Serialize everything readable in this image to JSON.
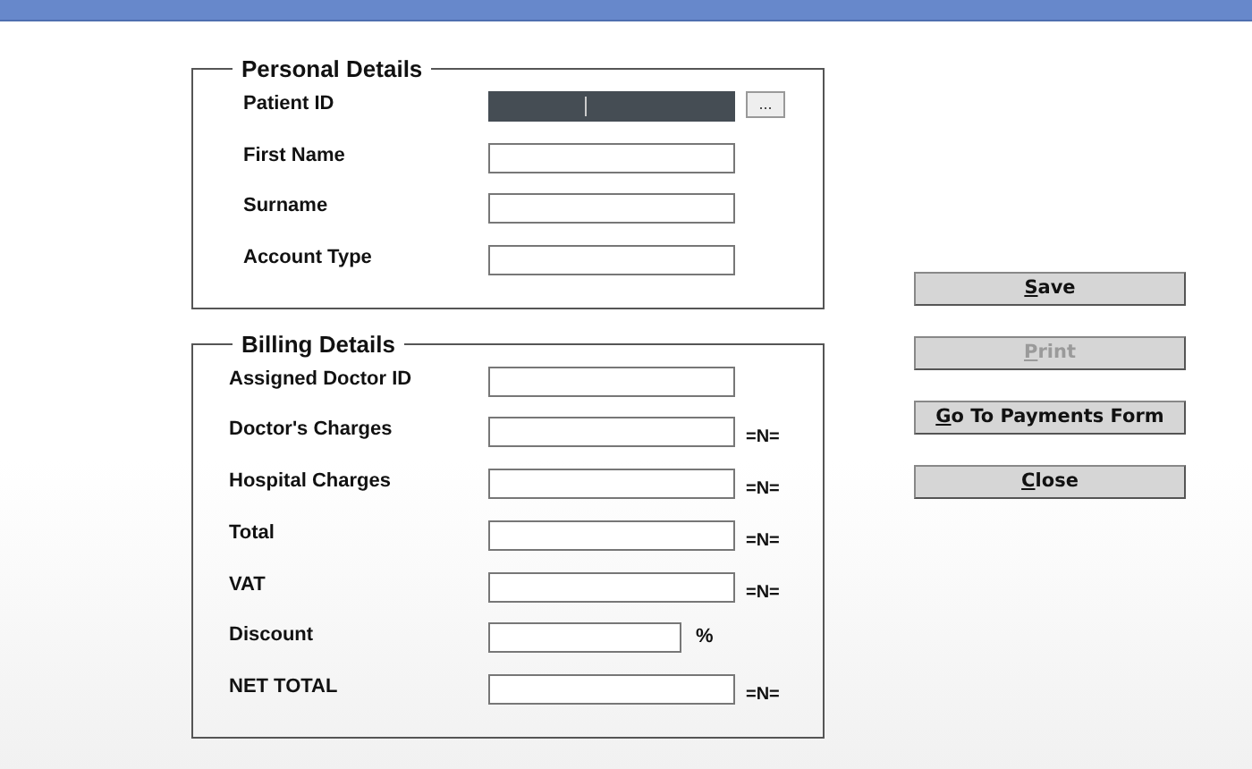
{
  "groups": [
    {
      "title": "Personal Details",
      "fields": [
        {
          "label": "Patient ID",
          "kind": "browse",
          "highlighted": true,
          "button": "..."
        },
        {
          "label": "First Name",
          "kind": "text",
          "highlighted": false
        },
        {
          "label": "Surname",
          "kind": "text",
          "highlighted": false
        },
        {
          "label": "Account Type",
          "kind": "text",
          "highlighted": false
        }
      ]
    },
    {
      "title": "Billing Details",
      "fields": [
        {
          "label": "Assigned Doctor ID",
          "kind": "text",
          "highlighted": false
        },
        {
          "label": "Doctor's Charges",
          "kind": "text",
          "highlighted": false,
          "suffix": "=N="
        },
        {
          "label": "Hospital Charges",
          "kind": "text",
          "highlighted": false,
          "suffix": "=N="
        },
        {
          "label": "Total",
          "kind": "text",
          "highlighted": false,
          "suffix": "=N="
        },
        {
          "label": "VAT",
          "kind": "text",
          "highlighted": false,
          "suffix": "=N="
        },
        {
          "label": "Discount",
          "kind": "short",
          "highlighted": false,
          "suffix": "%"
        },
        {
          "label": "NET TOTAL",
          "kind": "text",
          "highlighted": false,
          "suffix": "=N="
        }
      ]
    }
  ],
  "buttons": [
    {
      "label": "Save",
      "disabled": false,
      "underline_first": true
    },
    {
      "label": "Print",
      "disabled": true,
      "underline_first": true
    },
    {
      "label": "Go To Payments Form",
      "disabled": false,
      "underline_first": true
    },
    {
      "label": "Close",
      "disabled": false,
      "underline_first": true
    }
  ]
}
